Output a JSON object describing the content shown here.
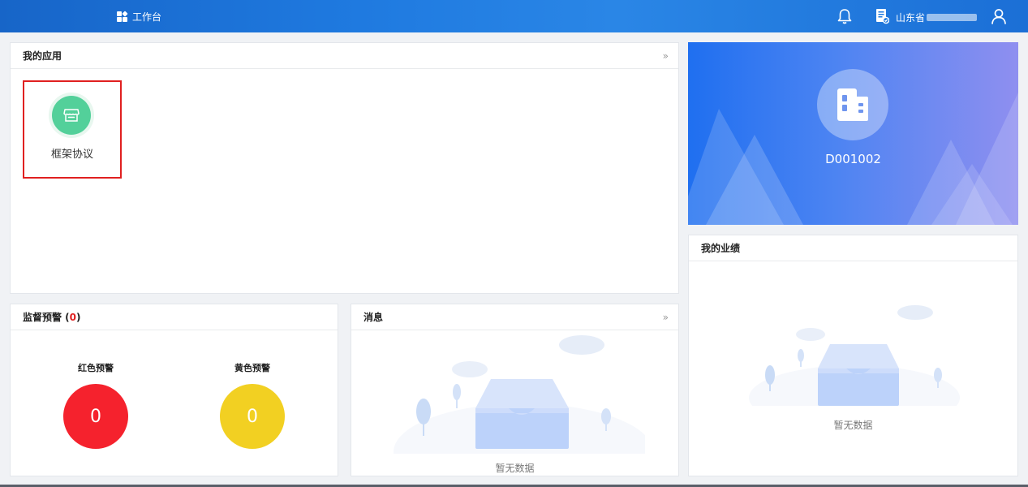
{
  "topbar": {
    "workbench_label": "工作台",
    "user_name": "山东省",
    "icons": [
      "grid-icon",
      "bell-icon",
      "document-icon",
      "user-icon"
    ]
  },
  "apps_panel": {
    "title": "我的应用",
    "more": "»",
    "apps": [
      {
        "label": "框架协议",
        "icon": "store-icon",
        "color": "#53d09a"
      }
    ]
  },
  "org_card": {
    "code": "D001002",
    "icon": "building-icon"
  },
  "performance_panel": {
    "title": "我的业绩",
    "empty_text": "暂无数据"
  },
  "warning_panel": {
    "title_prefix": "监督预警 (",
    "count": "0",
    "title_suffix": ")",
    "red": {
      "label": "红色预警",
      "value": "0",
      "color": "#f5222d"
    },
    "yellow": {
      "label": "黄色预警",
      "value": "0",
      "color": "#f2d022"
    }
  },
  "message_panel": {
    "title": "消息",
    "more": "»",
    "empty_text": "暂无数据"
  },
  "colors": {
    "topbar": "#1f7ae0",
    "accent_red": "#e02020"
  }
}
